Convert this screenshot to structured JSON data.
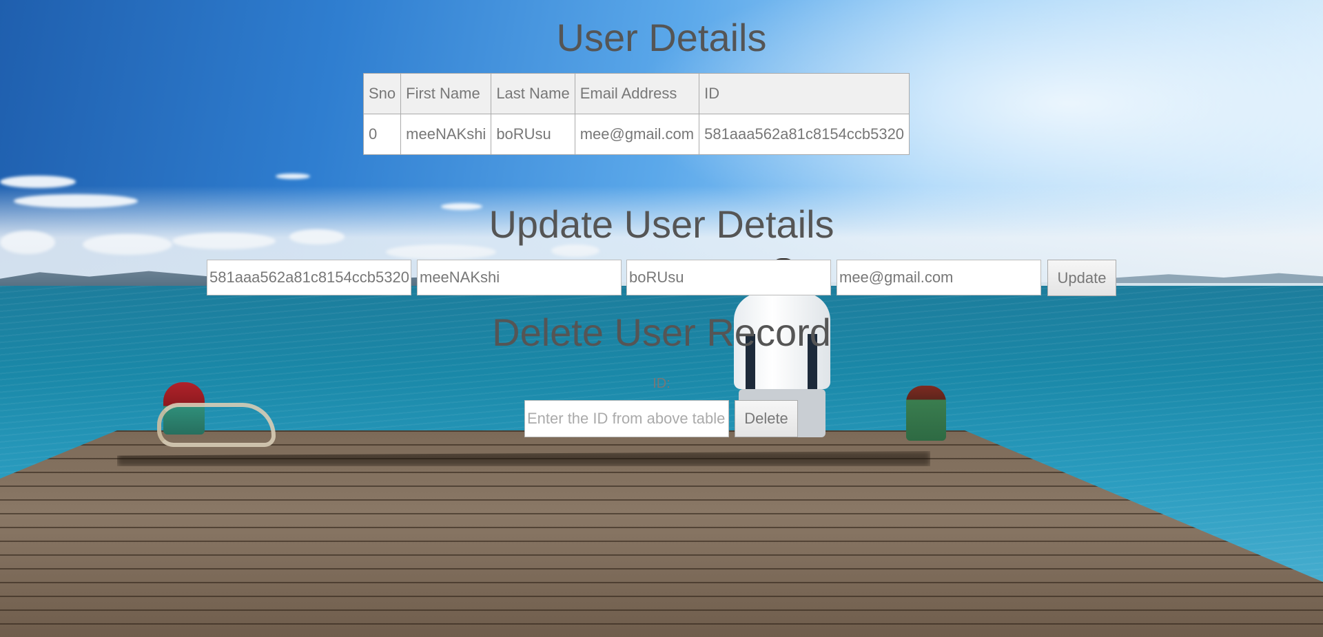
{
  "user_details": {
    "title": "User Details",
    "columns": [
      "Sno",
      "First Name",
      "Last Name",
      "Email Address",
      "ID"
    ],
    "rows": [
      [
        "0",
        "meeNAKshi",
        "boRUsu",
        "mee@gmail.com",
        "581aaa562a81c8154ccb5320"
      ]
    ]
  },
  "update": {
    "title": "Update User Details",
    "id_value": "581aaa562a81c8154ccb5320",
    "first_name_value": "meeNAKshi",
    "last_name_value": "boRUsu",
    "email_value": "mee@gmail.com",
    "button_label": "Update"
  },
  "delete": {
    "title": "Delete User Record",
    "id_label": "ID:",
    "id_placeholder": "Enter the ID from above table",
    "button_label": "Delete"
  }
}
